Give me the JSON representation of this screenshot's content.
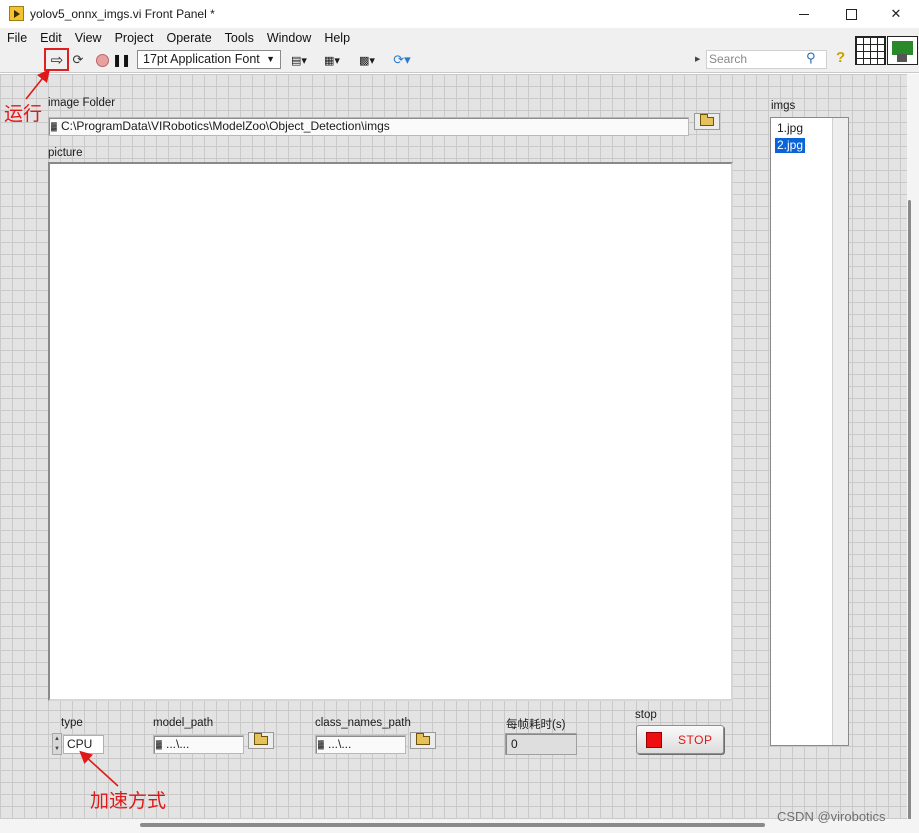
{
  "window": {
    "title": "yolov5_onnx_imgs.vi Front Panel *"
  },
  "menu": [
    "File",
    "Edit",
    "View",
    "Project",
    "Operate",
    "Tools",
    "Window",
    "Help"
  ],
  "toolbar": {
    "font_select": "17pt Application Font",
    "search_placeholder": "Search"
  },
  "panel": {
    "image_folder": {
      "label": "image Folder",
      "value": "C:\\ProgramData\\VIRobotics\\ModelZoo\\Object_Detection\\imgs"
    },
    "picture": {
      "label": "picture"
    },
    "imgs": {
      "label": "imgs",
      "items": [
        "1.jpg",
        "2.jpg"
      ],
      "selected_index": 1
    },
    "type": {
      "label": "type",
      "value": "CPU"
    },
    "model_path": {
      "label": "model_path",
      "value": "...\\..."
    },
    "class_names_path": {
      "label": "class_names_path",
      "value": "...\\..."
    },
    "frame_time": {
      "label": "每帧耗时(s)",
      "value": "0"
    },
    "stop": {
      "label": "stop",
      "button_text": "STOP"
    }
  },
  "annotations": {
    "run": "运行",
    "accel": "加速方式"
  },
  "watermark": "CSDN @virobotics",
  "colors": {
    "annotation_red": "#e01818",
    "selection_blue": "#0a64d8",
    "panel_grid_bg": "#e3e3e3",
    "stop_red": "#ee1010"
  }
}
